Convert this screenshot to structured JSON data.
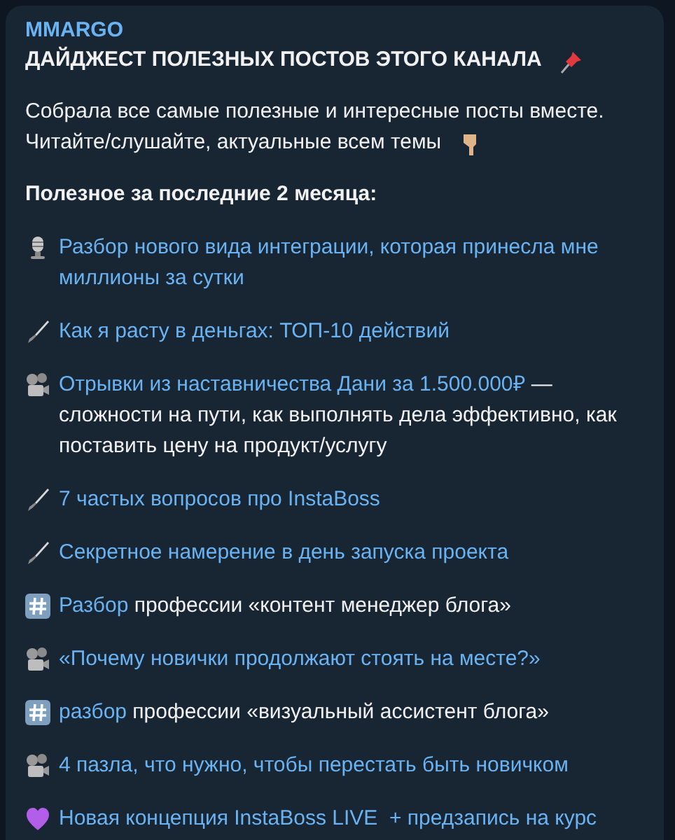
{
  "message": {
    "author": "MMARGO",
    "title": "ДАЙДЖЕСТ ПОЛЕЗНЫХ ПОСТОВ ЭТОГО КАНАЛА",
    "intro": [
      "Собрала все самые полезные и интересные посты вместе.",
      "Читайте/слушайте, актуальные всем темы"
    ],
    "heading": "Полезное за последние 2 месяца:",
    "posts": [
      {
        "kind": "microphone",
        "link": "Разбор нового вида интеграции, которая принесла мне миллионы за сутки"
      },
      {
        "kind": "brush",
        "link": "Как я расту в деньгах: ТОП-10 действий"
      },
      {
        "kind": "projector",
        "link": "Отрывки из наставничества Дани за 1.500.000₽",
        "text": " — сложности на пути, как выполнять дела эффективно, как поставить цену на продукт/услугу"
      },
      {
        "kind": "brush",
        "link": "7 частых вопросов про InstaBoss"
      },
      {
        "kind": "brush",
        "link": "Секретное намерение в день запуска проекта"
      },
      {
        "kind": "hashtag",
        "link": "Разбор",
        "text": " профессии «контент менеджер блога»"
      },
      {
        "kind": "projector",
        "link": "«Почему новички продолжают стоять на месте?»"
      },
      {
        "kind": "hashtag",
        "link": "разбор",
        "text": " профессии «визуальный ассистент блога»"
      },
      {
        "kind": "projector",
        "link": "4 пазла, что нужно, чтобы перестать быть новичком"
      },
      {
        "kind": "heart",
        "link": "Новая концепция InstaBoss LIVE  + предзапись на курс"
      }
    ]
  }
}
